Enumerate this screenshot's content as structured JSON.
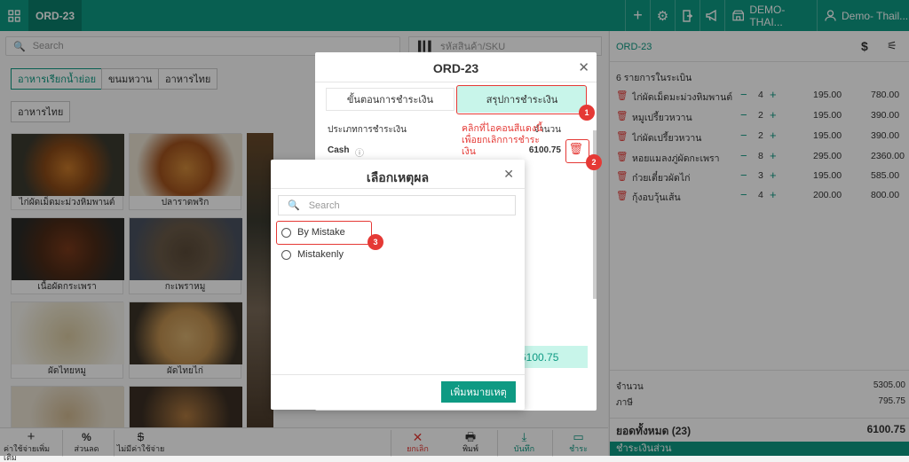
{
  "topbar": {
    "order_tab": "ORD-23",
    "store": "DEMO-THAI...",
    "user": "Demo- Thail..."
  },
  "left": {
    "search_placeholder": "Search",
    "sku_placeholder": "รหัสสินค้า/SKU",
    "categories": [
      "อาหารเรียกน้ำย่อย",
      "ขนมหวาน",
      "อาหารไทย",
      "อาหารไทย"
    ],
    "items": [
      "ไก่ผัดเม็ดมะม่วงหิมพานต์",
      "ปลาราดพริก",
      "เนื้อผัดกระเพรา",
      "กะเพราหมู",
      "ผัดไทยหมู",
      "ผัดไทยไก่"
    ]
  },
  "bottom": {
    "add_charge": "ค่าใช้จ่ายเพิ่มเติม",
    "discount": "ส่วนลด",
    "no_charge": "ไม่มีค่าใช้จ่าย",
    "cancel": "ยกเลิก",
    "print": "พิมพ์",
    "save": "บันทึก",
    "pay": "ชำระ"
  },
  "right": {
    "order_id": "ORD-23",
    "count_label": "6 รายการในระเบิน",
    "items": [
      {
        "name": "ไก่ผัดเม็ดมะม่วงหิมพานต์",
        "qty": "4",
        "price": "195.00",
        "total": "780.00"
      },
      {
        "name": "หมูเปรี้ยวหวาน",
        "qty": "2",
        "price": "195.00",
        "total": "390.00"
      },
      {
        "name": "ไก่ผัดเปรี้ยวหวาน",
        "qty": "2",
        "price": "195.00",
        "total": "390.00"
      },
      {
        "name": "หอยแมลงภู่ผัดกะเพรา",
        "qty": "8",
        "price": "295.00",
        "total": "2360.00"
      },
      {
        "name": "ก๋วยเตี๋ยวผัดไก่",
        "qty": "3",
        "price": "195.00",
        "total": "585.00"
      },
      {
        "name": "กุ้งอบวุ้นเส้น",
        "qty": "4",
        "price": "200.00",
        "total": "800.00"
      }
    ],
    "subtotal_label": "จำนวน",
    "subtotal": "5305.00",
    "tax_label": "ภาษี",
    "tax": "795.75",
    "grand_label": "ยอดทั้งหมด (23)",
    "grand": "6100.75",
    "footer_label": "ชำระเงินส่วน"
  },
  "payment_dialog": {
    "title": "ORD-23",
    "tab_steps": "ขั้นตอนการชำระเงิน",
    "tab_summary": "สรุปการชำระเงิน",
    "col_type": "ประเภทการชำระเงิน",
    "col_amount": "จำนวน",
    "method": "Cash",
    "amount": "6100.75",
    "total": "6100.75",
    "hint": "คลิกที่ไอคอนสีแดงนี้เพื่อยกเลิกการชำระเงิน"
  },
  "reason_dialog": {
    "title": "เลือกเหตุผล",
    "search_placeholder": "Search",
    "options": [
      "By Mistake",
      "Mistakenly"
    ],
    "add_button": "เพิ่มหมายเหตุ"
  },
  "annotations": [
    "1",
    "2",
    "3"
  ],
  "colors": {
    "accent": "#0e9a83",
    "highlight": "#e53935",
    "tab_active": "#c8f5ea"
  }
}
